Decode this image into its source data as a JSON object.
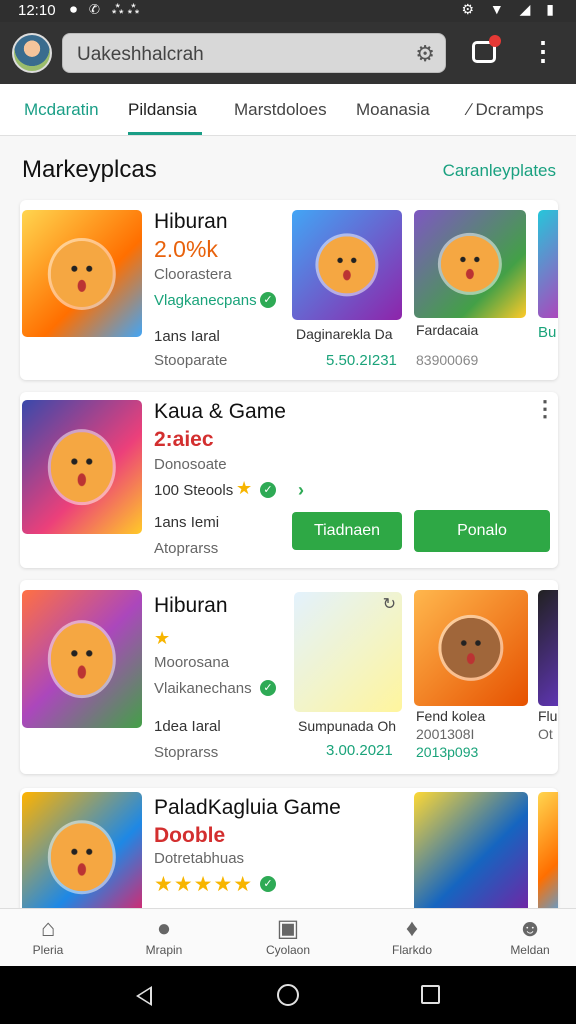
{
  "status_bar": {
    "time": "12:10",
    "left_icons": "⏺ ✆ ⁂⁂",
    "right_icons": "⚙ ▼ ◢ ▮"
  },
  "top_bar": {
    "search_query": "Uakeshhalcrah"
  },
  "tabs": [
    {
      "label": "Mcdaratin"
    },
    {
      "label": "Pildansia"
    },
    {
      "label": "Marstdoloes"
    },
    {
      "label": "Moanasia"
    },
    {
      "label": "∕ Dcramps"
    }
  ],
  "section": {
    "title": "Markeyplcas",
    "link": "Caranleyplates"
  },
  "cards": [
    {
      "title": "Hiburan",
      "subtitle": "2.0%k",
      "line1": "Cloorastera",
      "line2": "Vlagkanecpans",
      "line3": "1ans Iaral",
      "line4": "Stooparate",
      "tiles": [
        {
          "name": "Daginarekla Da",
          "price": "5.50.2I231"
        },
        {
          "name": "Fardacaia",
          "price": "83900069"
        },
        {
          "name": "Bu"
        }
      ]
    },
    {
      "title": "Kaua & Game",
      "subtitle": "2:aiec",
      "line1": "Donosoate",
      "line2": "100 Steools",
      "line3": "1ans Iemi",
      "line4": "Atoprarss",
      "primary_button": "Tiadnaen",
      "secondary_button": "Ponalo"
    },
    {
      "title": "Hiburan",
      "line1": "Moorosana",
      "line2": "Vlaikanechans",
      "line3": "1dea Iaral",
      "line4": "Stoprarss",
      "tiles": [
        {
          "name": "Sumpunada Oh",
          "price": "3.00.2021"
        },
        {
          "name": "Fend kolea",
          "price2": "2001308I",
          "price": "2013p093"
        },
        {
          "name": "Flu",
          "price": "Ot"
        }
      ]
    },
    {
      "title": "PaladKagluia Game",
      "subtitle": "Dooble",
      "line1": "Dotretabhuas",
      "stars": "★★★★★"
    }
  ],
  "bottom_nav": [
    {
      "label": "Pleria",
      "icon": "home-icon"
    },
    {
      "label": "Mrapin",
      "icon": "chat-icon"
    },
    {
      "label": "Cyolaon",
      "icon": "apps-icon"
    },
    {
      "label": "Flarkdo",
      "icon": "location-icon"
    },
    {
      "label": "Meldan",
      "icon": "profile-icon"
    }
  ],
  "colors": {
    "accent": "#1a9e86",
    "button": "#2ea845",
    "price": "#1aa37a",
    "orange": "#e8620c",
    "red": "#d32f2f"
  }
}
